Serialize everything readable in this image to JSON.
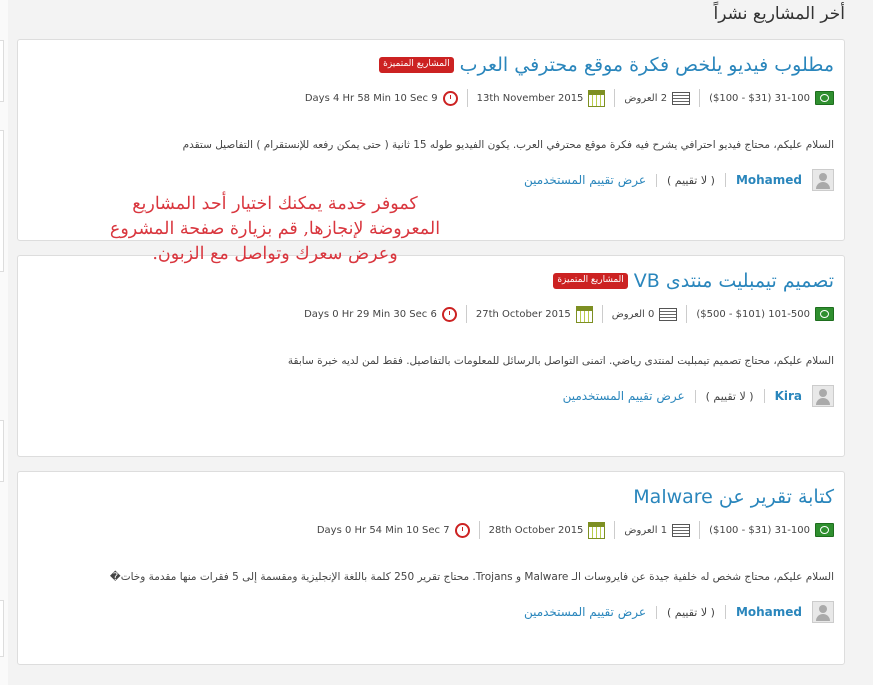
{
  "section_title": "أخر المشاريع نشراً",
  "featured_badge": "المشاريع المتميزة",
  "no_rating": "( لا تقييم )",
  "view_ratings": "عرض تقييم المستخدمين",
  "projects": [
    {
      "title": "مطلوب فيديو يلخص فكرة موقع محترفي العرب",
      "featured": true,
      "budget": "31-100 ($31 - $100)",
      "offers": "2 العروض",
      "date": "13th November 2015",
      "remaining": "9 Days 4 Hr 58 Min 10 Sec",
      "description": "السلام عليكم، محتاج فيديو احترافي يشرح فيه فكرة موقع محترفي العرب. يكون الفيديو طوله 15 ثانية ( حتى يمكن رفعه للإنستقرام ) التفاصيل ستقدم",
      "user": "Mohamed"
    },
    {
      "title": "تصميم تيمبليت منتدى VB",
      "featured": true,
      "budget": "101-500 ($101 - $500)",
      "offers": "0 العروض",
      "date": "27th October 2015",
      "remaining": "6 Days 0 Hr 29 Min 30 Sec",
      "description": "السلام عليكم، محتاج تصميم تيمبليت لمنتدى رياضي. اتمنى التواصل بالرسائل للمعلومات بالتفاصيل. فقط لمن لديه خبرة سابقة",
      "user": "Kira"
    },
    {
      "title": "كتابة تقرير عن Malware",
      "featured": false,
      "budget": "31-100 ($31 - $100)",
      "offers": "1 العروض",
      "date": "28th October 2015",
      "remaining": "7 Days 0 Hr 54 Min 10 Sec",
      "description": "السلام عليكم، محتاج شخص له خلفية جيدة عن فايروسات الـ Malware و Trojans. محتاج تقرير 250 كلمة باللغة الإنجليزية ومقسمة إلى 5 فقرات منها مقدمة وخات�",
      "user": "Mohamed"
    }
  ],
  "annotation": {
    "lines": [
      "كموفر خدمة يمكنك اختيار أحد المشاريع",
      "المعروضة لإنجازها, قم بزيارة صفحة المشروع",
      "وعرض سعرك وتواصل مع الزبون."
    ],
    "color": "#d9363e"
  },
  "colors": {
    "link": "#2a86bc",
    "badge": "#cc2222"
  }
}
